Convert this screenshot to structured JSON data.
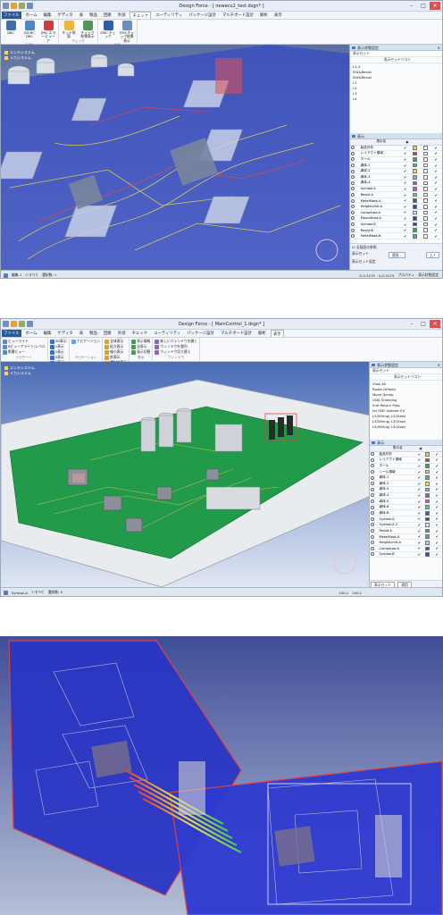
{
  "screen1": {
    "title": "Design Force - [ newecu2_test.dsgn* ]",
    "menu": [
      "ファイル",
      "ホーム",
      "編集",
      "ゲディタ",
      "表",
      "製品",
      "回路",
      "外部",
      "チェック",
      "ユーティリティ",
      "パッケージ設計",
      "マルチボード設計",
      "解析",
      "表示"
    ],
    "active_menu": "チェック",
    "ribbon_groups": [
      {
        "label": "CAM",
        "buttons": [
          "DRC",
          "RS/RC DRC",
          "DRC エラービューア"
        ]
      },
      {
        "label": "チェック",
        "buttons": [
          "ネット探索",
          "チェック結果表示"
        ]
      },
      {
        "label": "EMC",
        "buttons": [
          "EMC チェック",
          "EMCチェック結果表示"
        ]
      }
    ],
    "tree": [
      "エレキシステム",
      "メカシステム"
    ],
    "sidepanel": {
      "header": "表示状態設定",
      "set_header": "表示セット",
      "set_list_header": "表示セットリスト",
      "sets": [
        "L1-4",
        "Silk&Resist",
        "Silk&Resist",
        "L1",
        "L2",
        "L3",
        "L4"
      ],
      "layer_header": "表示",
      "layer_col": "表示名",
      "layers": [
        {
          "name": "製品外形",
          "color": "#f3d23c"
        },
        {
          "name": "レイアウト領域",
          "color": "#d8304a"
        },
        {
          "name": "ホール",
          "color": "#3fa84f"
        },
        {
          "name": "導体-1",
          "color": "#35c36a"
        },
        {
          "name": "導体-2",
          "color": "#f3e04a"
        },
        {
          "name": "導体-3",
          "color": "#54c9e6"
        },
        {
          "name": "導体-4",
          "color": "#b54ac9"
        },
        {
          "name": "Symbol-A",
          "color": "#d94ac6"
        },
        {
          "name": "Resist-A",
          "color": "#4cd7a2"
        },
        {
          "name": "MetalMask-A",
          "color": "#2f5dbf"
        },
        {
          "name": "HeightLimit-A",
          "color": "#3a3ac9"
        },
        {
          "name": "CompArea-A",
          "color": "#e7e5f7"
        },
        {
          "name": "MountArea-A",
          "color": "#3a3ac9"
        },
        {
          "name": "Symbol-B",
          "color": "#3a3ac9"
        },
        {
          "name": "Resist-B",
          "color": "#29b24b"
        },
        {
          "name": "MetalMask-B",
          "color": "#3ca7d9"
        }
      ],
      "checkbox_label": "全画面の参照",
      "set_btn": "表示セット",
      "setting_btn": "表示セット設定",
      "apply_btn": "適用...",
      "up_btn": "上↑",
      "tabs": [
        "プロパティ",
        "表示状態設定"
      ]
    },
    "status": [
      "編集-1",
      "7:すべて",
      "選択数: 1",
      "G-0.3175",
      "G-0.3175"
    ]
  },
  "screen2": {
    "title": "Design Force - [ MainControl_1.dsgn* ]",
    "menu": [
      "ファイル",
      "ホーム",
      "編集",
      "ゲディタ",
      "表",
      "製品",
      "回路",
      "外部",
      "チェック",
      "ユーティリティ",
      "パッケージ設計",
      "マルチボード設計",
      "解析",
      "表示"
    ],
    "active_menu": "表示",
    "ribbon_groups": [
      {
        "label": "ナビゲート",
        "items": [
          "ビューライト",
          "Bビューアライト/レベル",
          "影響ビュー"
        ]
      },
      {
        "label": "ワーク表示",
        "items": [
          "3D表示",
          "1表示",
          "2表示",
          "3表示",
          "4表示"
        ]
      },
      {
        "label": "ナビゲーション",
        "items": [
          "ナビゲーション"
        ]
      },
      {
        "label": "ツール表示",
        "items": [
          "全体表示",
          "拡大表示",
          "縮小表示",
          "前表示",
          "選択部表示"
        ]
      },
      {
        "label": "表示",
        "items": [
          "表示情報",
          "全表示",
          "表示切替"
        ]
      },
      {
        "label": "ウィンドウ",
        "items": [
          "新しいウィンドウを開く",
          "ウィンドウを整列",
          "ウィンドウ切り替え"
        ]
      }
    ],
    "tree": [
      "エレキシステム",
      "メカシステム"
    ],
    "sidepanel": {
      "header": "表示状態設定",
      "set_header": "表示セット",
      "set_list_header": "表示セットリスト",
      "sets": [
        "View All",
        "Route Diffpair",
        "Move Decap",
        "GND Shielding",
        "Edit Return Pass",
        "for EMC Adviser EX",
        "L2(Wiring) L2(View)",
        "L3(Wiring) L3(View)",
        "L4(Wiring) L4(View)"
      ],
      "layer_header": "表示",
      "layer_col": "表示名",
      "layers": [
        "製品外形",
        "レイアウト領域",
        "ホール",
        "シール領域",
        "導体-1",
        "導体-2",
        "導体-3",
        "導体-4",
        "導体-5",
        "導体-6",
        "導体-B",
        "Symbol-A",
        "Symbol-A 2",
        "Resist-A",
        "MetalMask-A",
        "HeightLimit-A",
        "CompArea-A",
        "Symbol-B"
      ],
      "tabs": [
        "表示セット",
        "適用"
      ]
    },
    "status": [
      "Symbol-A",
      "7:すべて",
      "選択数: 0",
      "100.1",
      "100.1"
    ]
  }
}
